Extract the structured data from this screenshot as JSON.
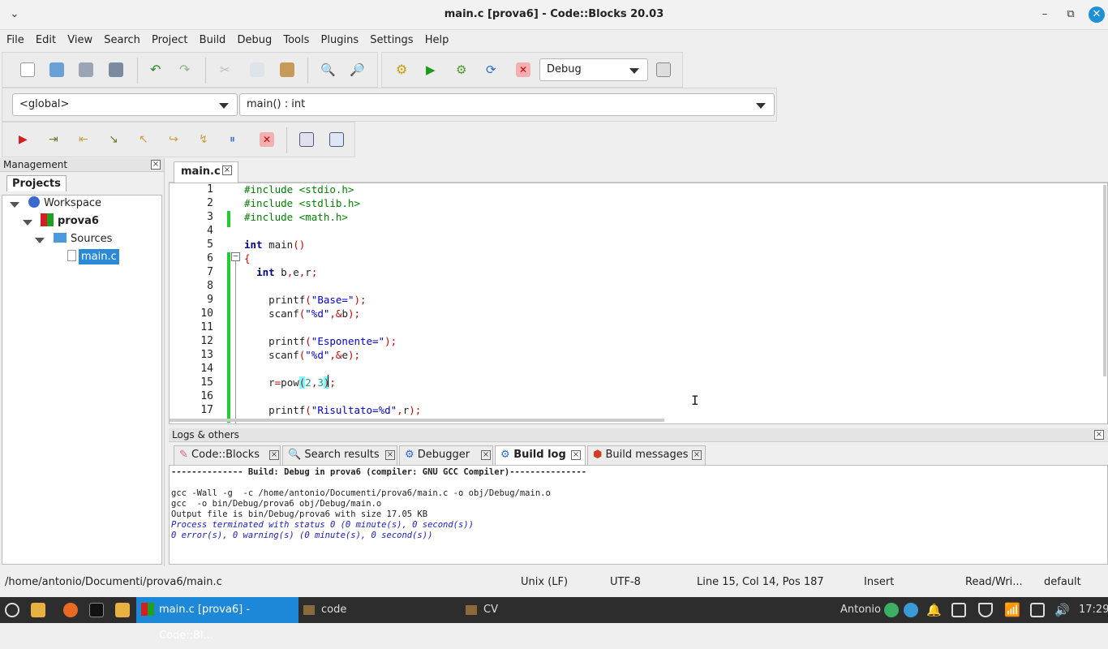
{
  "window": {
    "title": "main.c [prova6] - Code::Blocks 20.03"
  },
  "menu": [
    "File",
    "Edit",
    "View",
    "Search",
    "Project",
    "Build",
    "Debug",
    "Tools",
    "Plugins",
    "Settings",
    "Help"
  ],
  "toolbar": {
    "build_target": "Debug"
  },
  "code_toolbar": {
    "scope": "<global>",
    "function": "main() : int"
  },
  "management": {
    "title": "Management",
    "tab": "Projects",
    "tree": {
      "workspace": "Workspace",
      "project": "prova6",
      "folder": "Sources",
      "file": "main.c"
    }
  },
  "editor": {
    "tab": "main.c",
    "lines": [
      {
        "n": "1",
        "html": "<span class='pp'>#include &lt;stdio.h&gt;</span>"
      },
      {
        "n": "2",
        "html": "<span class='pp'>#include &lt;stdlib.h&gt;</span>"
      },
      {
        "n": "3",
        "html": "<span class='pp'>#include &lt;math.h&gt;</span>"
      },
      {
        "n": "4",
        "html": ""
      },
      {
        "n": "5",
        "html": "<span class='kw'>int</span> main<span class='op'>()</span>"
      },
      {
        "n": "6",
        "html": "<span class='op'>{</span>"
      },
      {
        "n": "7",
        "html": "  <span class='kw'>int</span> b<span class='op'>,</span>e<span class='op'>,</span>r<span class='op'>;</span>"
      },
      {
        "n": "8",
        "html": ""
      },
      {
        "n": "9",
        "html": "    printf<span class='op'>(</span><span class='str'>\"Base=\"</span><span class='op'>);</span>"
      },
      {
        "n": "10",
        "html": "    scanf<span class='op'>(</span><span class='str'>\"%d\"</span><span class='op'>,&amp;</span>b<span class='op'>);</span>"
      },
      {
        "n": "11",
        "html": ""
      },
      {
        "n": "12",
        "html": "    printf<span class='op'>(</span><span class='str'>\"Esponente=\"</span><span class='op'>);</span>"
      },
      {
        "n": "13",
        "html": "    scanf<span class='op'>(</span><span class='str'>\"%d\"</span><span class='op'>,&amp;</span>e<span class='op'>);</span>"
      },
      {
        "n": "14",
        "html": ""
      },
      {
        "n": "15",
        "html": "    r<span class='op'>=</span>pow<span class='op' style='background:#7ff;'>(</span><span class='num'>2</span><span class='op'>,</span><span class='num'>3</span><span class='op' style='background:#7ff;'>)</span><span class='op'>;</span>"
      },
      {
        "n": "16",
        "html": ""
      },
      {
        "n": "17",
        "html": "    printf<span class='op'>(</span><span class='str'>\"Risultato=%d\"</span><span class='op'>,</span>r<span class='op'>);</span>"
      }
    ]
  },
  "logs": {
    "title": "Logs & others",
    "tabs": [
      "Code::Blocks",
      "Search results",
      "Debugger",
      "Build log",
      "Build messages"
    ],
    "lines": [
      "-------------- Build: Debug in prova6 (compiler: GNU GCC Compiler)---------------",
      "",
      "gcc -Wall -g  -c /home/antonio/Documenti/prova6/main.c -o obj/Debug/main.o",
      "gcc  -o bin/Debug/prova6 obj/Debug/main.o",
      "Output file is bin/Debug/prova6 with size 17.05 KB",
      "Process terminated with status 0 (0 minute(s), 0 second(s))",
      "0 error(s), 0 warning(s) (0 minute(s), 0 second(s))"
    ]
  },
  "status": {
    "path": "/home/antonio/Documenti/prova6/main.c",
    "eol": "Unix (LF)",
    "encoding": "UTF-8",
    "position": "Line 15, Col 14, Pos 187",
    "mode": "Insert",
    "access": "Read/Wri...",
    "profile": "default"
  },
  "taskbar": {
    "active_window": "main.c [prova6] - Code::Bl...",
    "item2": "code",
    "item3": "CV",
    "user": "Antonio",
    "clock": "17:29"
  }
}
